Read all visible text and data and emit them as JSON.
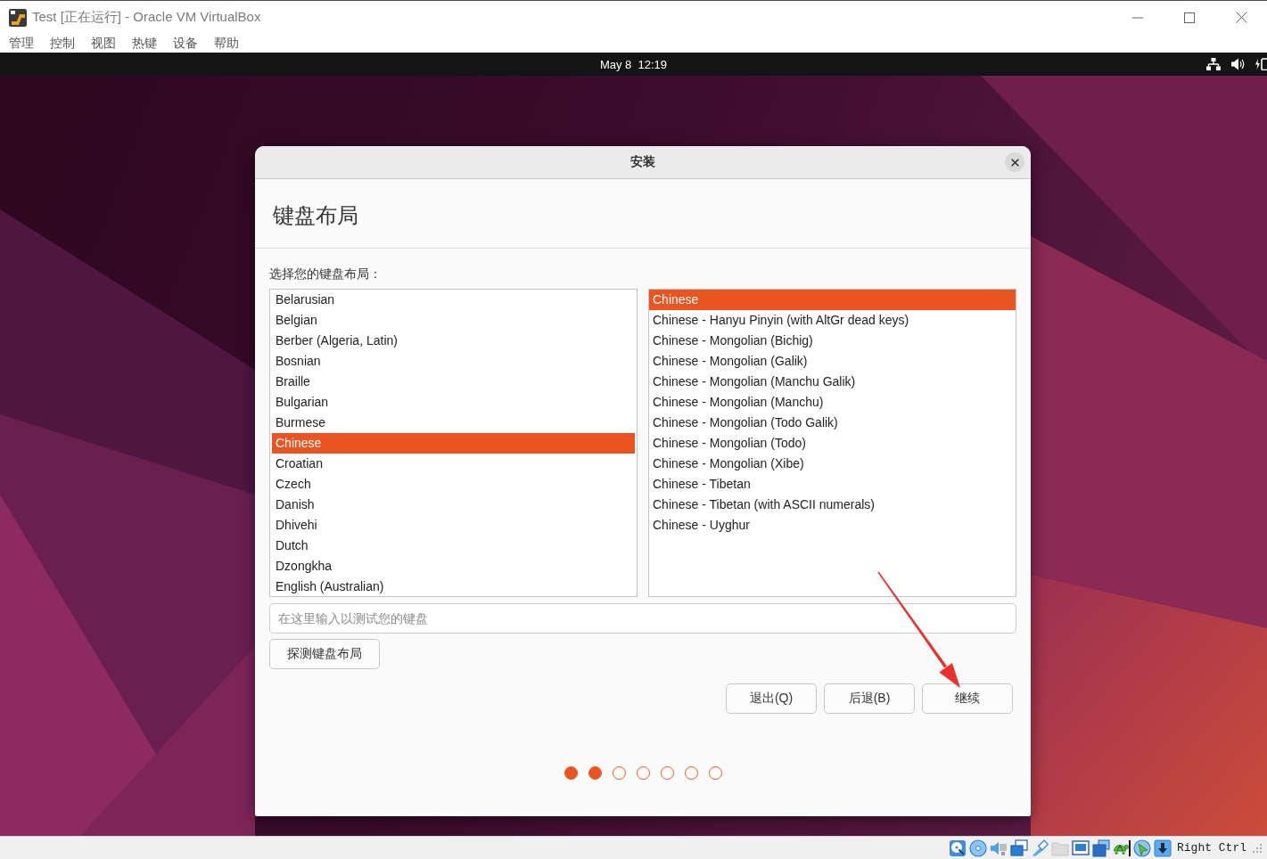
{
  "host_window": {
    "title": "Test [正在运行] - Oracle VM VirtualBox",
    "menu": [
      "管理",
      "控制",
      "视图",
      "热键",
      "设备",
      "帮助"
    ]
  },
  "guest_top_bar": {
    "clock": "May 8  12:19"
  },
  "dialog": {
    "title": "安装",
    "heading": "键盘布局",
    "prompt": "选择您的键盘布局：",
    "layouts": [
      {
        "label": "Belarusian",
        "selected": false
      },
      {
        "label": "Belgian",
        "selected": false
      },
      {
        "label": "Berber (Algeria, Latin)",
        "selected": false
      },
      {
        "label": "Bosnian",
        "selected": false
      },
      {
        "label": "Braille",
        "selected": false
      },
      {
        "label": "Bulgarian",
        "selected": false
      },
      {
        "label": "Burmese",
        "selected": false
      },
      {
        "label": "Chinese",
        "selected": true
      },
      {
        "label": "Croatian",
        "selected": false
      },
      {
        "label": "Czech",
        "selected": false
      },
      {
        "label": "Danish",
        "selected": false
      },
      {
        "label": "Dhivehi",
        "selected": false
      },
      {
        "label": "Dutch",
        "selected": false
      },
      {
        "label": "Dzongkha",
        "selected": false
      },
      {
        "label": "English (Australian)",
        "selected": false
      }
    ],
    "variants": [
      {
        "label": "Chinese",
        "selected": true
      },
      {
        "label": "Chinese - Hanyu Pinyin (with AltGr dead keys)",
        "selected": false
      },
      {
        "label": "Chinese - Mongolian (Bichig)",
        "selected": false
      },
      {
        "label": "Chinese - Mongolian (Galik)",
        "selected": false
      },
      {
        "label": "Chinese - Mongolian (Manchu Galik)",
        "selected": false
      },
      {
        "label": "Chinese - Mongolian (Manchu)",
        "selected": false
      },
      {
        "label": "Chinese - Mongolian (Todo Galik)",
        "selected": false
      },
      {
        "label": "Chinese - Mongolian (Todo)",
        "selected": false
      },
      {
        "label": "Chinese - Mongolian (Xibe)",
        "selected": false
      },
      {
        "label": "Chinese - Tibetan",
        "selected": false
      },
      {
        "label": "Chinese - Tibetan (with ASCII numerals)",
        "selected": false
      },
      {
        "label": "Chinese - Uyghur",
        "selected": false
      }
    ],
    "test_field": {
      "placeholder": "在这里输入以测试您的键盘"
    },
    "detect_button": "探测键盘布局",
    "buttons": [
      "退出(Q)",
      "后退(B)",
      "继续"
    ],
    "progress_dots": [
      {
        "done": true
      },
      {
        "done": true
      },
      {
        "done": false
      },
      {
        "done": false
      },
      {
        "done": false
      },
      {
        "done": false
      },
      {
        "done": false
      }
    ]
  },
  "status_bar": {
    "host_key": "Right Ctrl"
  }
}
